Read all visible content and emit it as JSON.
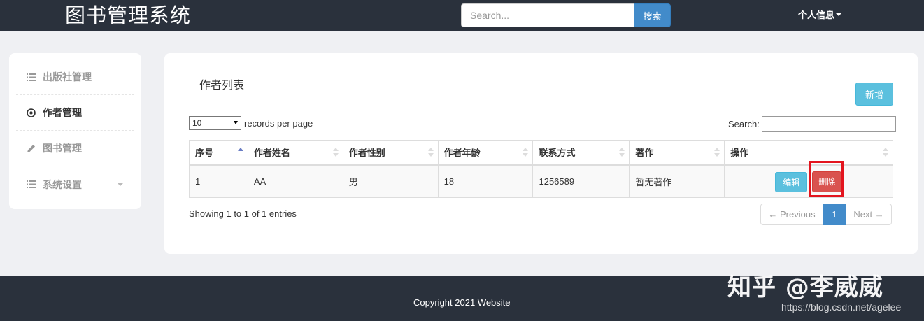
{
  "header": {
    "brand": "图书管理系统",
    "search_placeholder": "Search...",
    "search_button": "搜索",
    "user_menu": "个人信息"
  },
  "sidebar": {
    "items": [
      {
        "label": "出版社管理",
        "icon": "list-icon"
      },
      {
        "label": "作者管理",
        "icon": "circle-dot-icon"
      },
      {
        "label": "图书管理",
        "icon": "pencil-icon"
      },
      {
        "label": "系统设置",
        "icon": "list-icon"
      }
    ]
  },
  "main": {
    "title": "作者列表",
    "add_button": "新增",
    "page_length": "10",
    "length_label": "records per page",
    "search_label": "Search:",
    "columns": [
      "序号",
      "作者姓名",
      "作者性别",
      "作者年龄",
      "联系方式",
      "著作",
      "操作"
    ],
    "rows": [
      {
        "id": "1",
        "name": "AA",
        "gender": "男",
        "age": "18",
        "contact": "1256589",
        "works": "暂无著作"
      }
    ],
    "edit_button": "编辑",
    "delete_button": "删除",
    "info": "Showing 1 to 1 of 1 entries",
    "pagination": {
      "prev": "← Previous",
      "current": "1",
      "next": "Next →"
    }
  },
  "footer": {
    "copyright": "Copyright 2021",
    "link": "Website",
    "watermark": "知乎 @李威威",
    "watermark_url": "https://blog.csdn.net/agelee"
  },
  "colors": {
    "topbar": "#2a313c",
    "primary": "#428bca",
    "info": "#5bc0de",
    "danger": "#d9534f",
    "highlight": "#e3141e"
  }
}
